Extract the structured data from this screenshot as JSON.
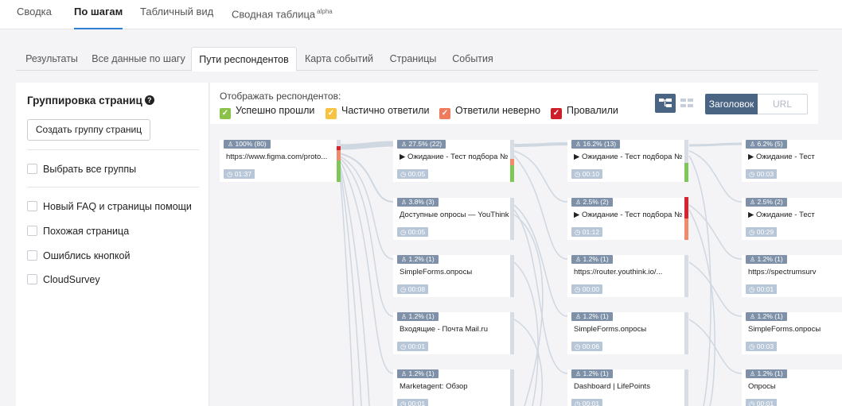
{
  "topnav": {
    "tabs": [
      {
        "label": "Сводка"
      },
      {
        "label": "По шагам"
      },
      {
        "label": "Табличный вид"
      },
      {
        "label": "Сводная таблица",
        "sup": "alpha"
      }
    ],
    "active_index": 1
  },
  "subtabs": {
    "items": [
      {
        "label": "Результаты"
      },
      {
        "label": "Все данные по шагу"
      },
      {
        "label": "Пути респондентов"
      },
      {
        "label": "Карта событий"
      },
      {
        "label": "Страницы"
      },
      {
        "label": "События"
      }
    ],
    "active_index": 2
  },
  "grouping": {
    "title": "Группировка страниц",
    "help_icon": "?",
    "create_button": "Создать группу страниц",
    "select_all": "Выбрать все группы",
    "groups": [
      {
        "label": "Новый FAQ и страницы помощи"
      },
      {
        "label": "Похожая страница"
      },
      {
        "label": "Ошиблись кнопкой"
      },
      {
        "label": "CloudSurvey"
      }
    ]
  },
  "display": {
    "label": "Отображать респондентов:",
    "filters": [
      {
        "label": "Успешно прошли",
        "color": "#8bc34a"
      },
      {
        "label": "Частично ответили",
        "color": "#f6c342"
      },
      {
        "label": "Ответили неверно",
        "color": "#ee7b5b"
      },
      {
        "label": "Провалили",
        "color": "#cc1f2a"
      }
    ],
    "segment": {
      "header": "Заголовок",
      "url": "URL"
    },
    "accent": "#4a6584"
  },
  "flow": {
    "columns": [
      {
        "nodes": [
          {
            "badge": "100% (80)",
            "title": "https://www.figma.com/proto...",
            "time": "01:37",
            "green": 0.5,
            "red": 0.1,
            "orange": 0.25
          }
        ]
      },
      {
        "nodes": [
          {
            "badge": "27.5% (22)",
            "title": "▶ Ожидание - Тест подбора №",
            "time": "00:05",
            "green": 0.4,
            "red": 0.0,
            "orange": 0.15
          },
          {
            "badge": "3.8% (3)",
            "title": "Доступные опросы — YouThink",
            "time": "00:05",
            "green": 0,
            "red": 0,
            "orange": 0
          },
          {
            "badge": "1.2% (1)",
            "title": "SimpleForms.опросы",
            "time": "00:08",
            "green": 0,
            "red": 0,
            "orange": 0
          },
          {
            "badge": "1.2% (1)",
            "title": "Входящие - Почта Mail.ru",
            "time": "00:01",
            "green": 0,
            "red": 0,
            "orange": 0
          },
          {
            "badge": "1.2% (1)",
            "title": "Marketagent: Обзор",
            "time": "00:01",
            "green": 0,
            "red": 0,
            "orange": 0
          }
        ]
      },
      {
        "nodes": [
          {
            "badge": "16.2% (13)",
            "title": "▶ Ожидание - Тест подбора №",
            "time": "00:10",
            "green": 0.45,
            "red": 0,
            "orange": 0
          },
          {
            "badge": "2.5% (2)",
            "title": "▶ Ожидание - Тест подбора №",
            "time": "01:12",
            "green": 0,
            "red": 0.5,
            "orange": 0.5
          },
          {
            "badge": "1.2% (1)",
            "title": "https://router.youthink.io/...",
            "time": "00:00",
            "green": 0,
            "red": 0,
            "orange": 0
          },
          {
            "badge": "1.2% (1)",
            "title": "SimpleForms.опросы",
            "time": "00:06",
            "green": 0,
            "red": 0,
            "orange": 0
          },
          {
            "badge": "1.2% (1)",
            "title": "Dashboard | LifePoints",
            "time": "00:01",
            "green": 0,
            "red": 0,
            "orange": 0
          }
        ]
      },
      {
        "nodes": [
          {
            "badge": "6.2% (5)",
            "title": "▶ Ожидание - Тест",
            "time": "00:03",
            "green": 0,
            "red": 0,
            "orange": 0
          },
          {
            "badge": "2.5% (2)",
            "title": "▶ Ожидание - Тест",
            "time": "00:29",
            "green": 0,
            "red": 0,
            "orange": 0
          },
          {
            "badge": "1.2% (1)",
            "title": "https://spectrumsurv",
            "time": "00:01",
            "green": 0,
            "red": 0,
            "orange": 0
          },
          {
            "badge": "1.2% (1)",
            "title": "SimpleForms.опросы",
            "time": "00:03",
            "green": 0,
            "red": 0,
            "orange": 0
          },
          {
            "badge": "1.2% (1)",
            "title": "Опросы",
            "time": "00:01",
            "green": 0,
            "red": 0,
            "orange": 0
          }
        ]
      }
    ]
  }
}
